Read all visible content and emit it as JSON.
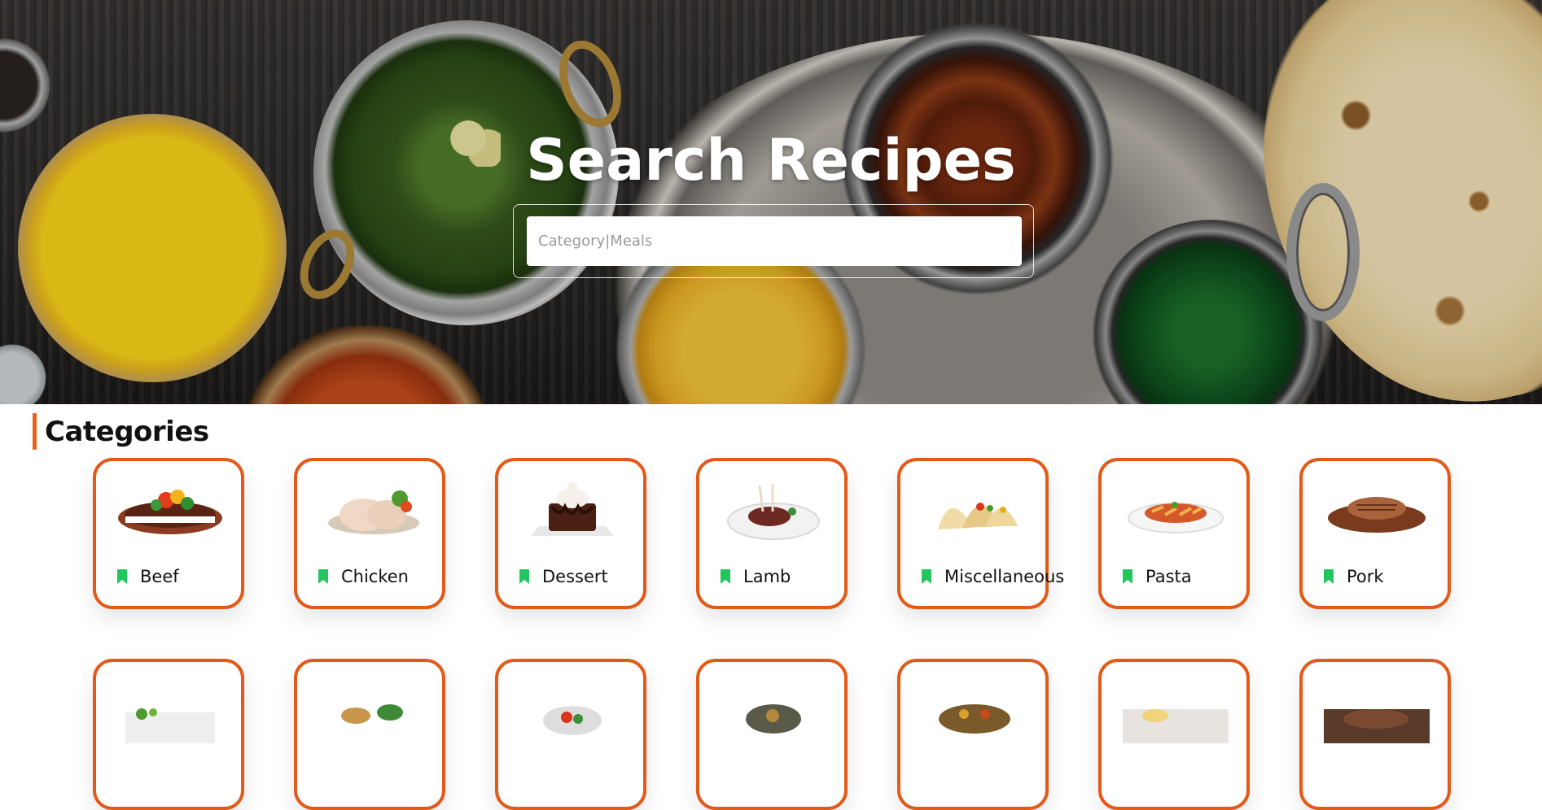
{
  "hero": {
    "title": "Search Recipes",
    "search_placeholder": "Category|Meals"
  },
  "categories": {
    "heading": "Categories",
    "accent_color": "#e8601c",
    "card_border_color": "#e35a18",
    "bookmark_color": "#22c55e",
    "items": [
      {
        "label": "Beef",
        "icon": "bookmark-icon"
      },
      {
        "label": "Chicken",
        "icon": "bookmark-icon"
      },
      {
        "label": "Dessert",
        "icon": "bookmark-icon"
      },
      {
        "label": "Lamb",
        "icon": "bookmark-icon"
      },
      {
        "label": "Miscellaneous",
        "icon": "bookmark-icon"
      },
      {
        "label": "Pasta",
        "icon": "bookmark-icon"
      },
      {
        "label": "Pork",
        "icon": "bookmark-icon"
      }
    ]
  }
}
